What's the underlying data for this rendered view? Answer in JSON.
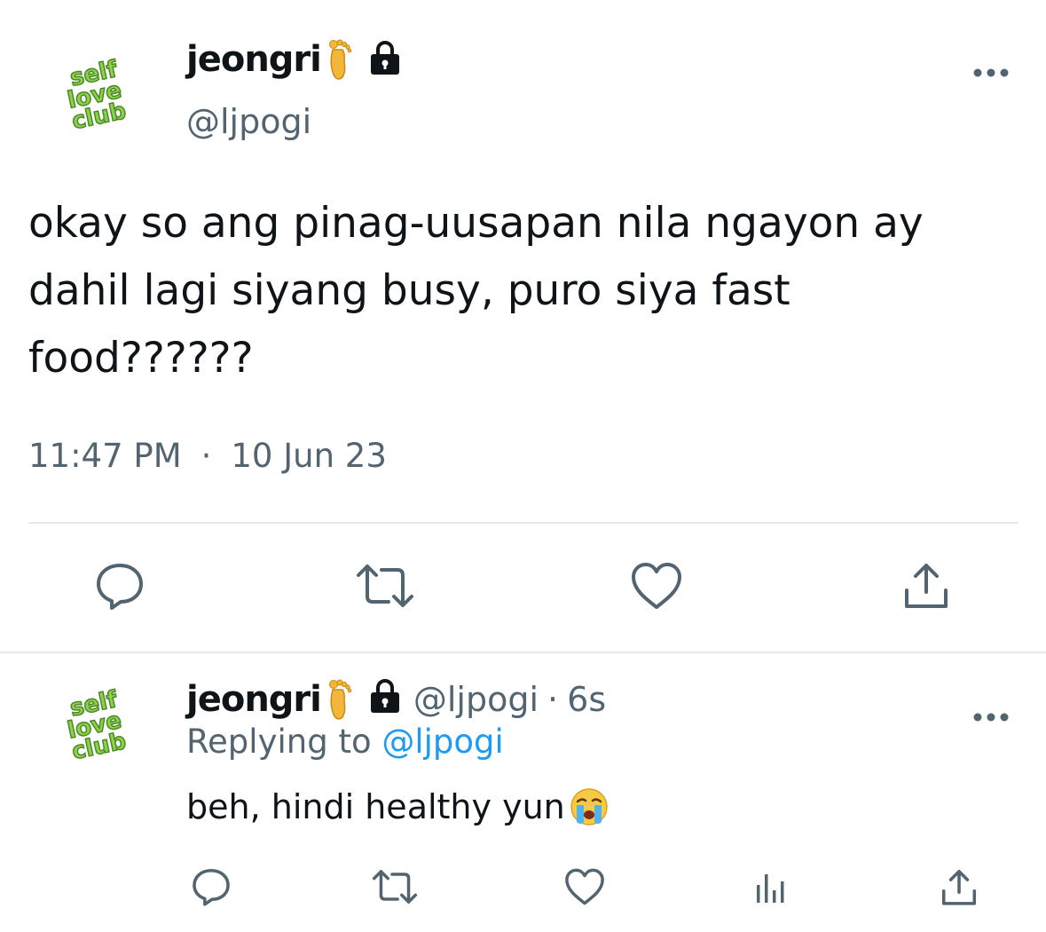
{
  "main_tweet": {
    "author": {
      "display_name": "jeongri",
      "handle": "@ljpogi",
      "avatar_text": [
        "self",
        "love",
        "club"
      ],
      "name_emoji": "foot-emoji",
      "protected_icon": "lock-icon"
    },
    "text": "okay so ang pinag-uusapan nila ngayon ay dahil lagi siyang busy, puro siya fast food??????",
    "time": "11:47 PM",
    "separator": "·",
    "date": "10 Jun 23",
    "more_icon": "more-icon",
    "actions": [
      "reply-icon",
      "retweet-icon",
      "like-icon",
      "share-icon"
    ]
  },
  "reply_tweet": {
    "author": {
      "display_name": "jeongri",
      "handle": "@ljpogi",
      "avatar_text": [
        "self",
        "love",
        "club"
      ]
    },
    "separator": "·",
    "age": "6s",
    "replying_to_label": "Replying to",
    "replying_to_handle": "@ljpogi",
    "text": "beh, hindi healthy yun",
    "text_emoji": "crying-face-emoji",
    "more_icon": "more-icon",
    "actions": [
      "reply-icon",
      "retweet-icon",
      "like-icon",
      "views-icon",
      "share-icon"
    ]
  },
  "colors": {
    "text": "#0f1419",
    "muted": "#536471",
    "link": "#1d9bf0",
    "divider": "#e6e9eb",
    "avatar_green": "#8ed14f",
    "avatar_dark_green": "#4a8a22"
  }
}
